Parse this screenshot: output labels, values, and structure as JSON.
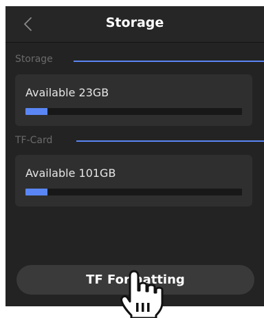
{
  "header": {
    "title": "Storage"
  },
  "storage": {
    "label": "Storage",
    "available_text": "Available 23GB",
    "used_fraction": 0.1
  },
  "tf_card": {
    "label": "TF-Card",
    "available_text": "Available 101GB",
    "used_fraction": 0.1
  },
  "actions": {
    "format_label": "TF Formatting"
  },
  "colors": {
    "accent": "#5a86f5",
    "background": "#232323",
    "card": "#2f2f2f"
  },
  "icons": {
    "back": "chevron-left-icon",
    "cursor": "hand-pointer-icon"
  }
}
